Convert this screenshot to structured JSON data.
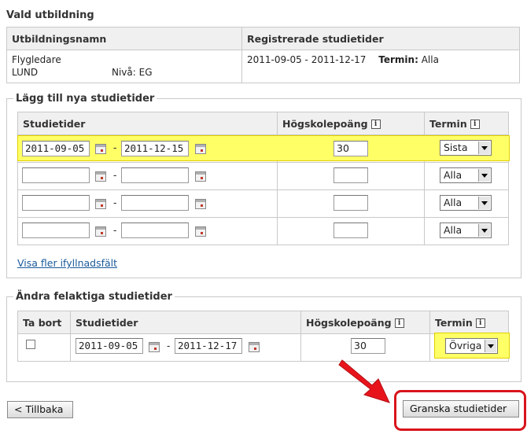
{
  "selected_education": {
    "title": "Vald utbildning",
    "col_name": "Utbildningsnamn",
    "col_registered": "Registrerade studietider",
    "name": "Flygledare",
    "location": "LUND",
    "level_label": "Nivå:",
    "level_value": "EG",
    "period": "2011-09-05 - 2011-12-17",
    "term_label": "Termin:",
    "term_value": "Alla"
  },
  "add_new": {
    "legend": "Lägg till nya studietider",
    "col_studietider": "Studietider",
    "col_hp": "Högskolepoäng",
    "col_termin": "Termin",
    "info_glyph": "i",
    "rows": [
      {
        "from": "2011-09-05",
        "to": "2011-12-15",
        "hp": "30",
        "term": "Sista"
      },
      {
        "from": "",
        "to": "",
        "hp": "",
        "term": "Alla"
      },
      {
        "from": "",
        "to": "",
        "hp": "",
        "term": "Alla"
      },
      {
        "from": "",
        "to": "",
        "hp": "",
        "term": "Alla"
      }
    ],
    "dash": "-",
    "more_fields_link": "Visa fler ifyllnadsfält"
  },
  "change_wrong": {
    "legend": "Ändra felaktiga studietider",
    "col_remove": "Ta bort",
    "col_studietider": "Studietider",
    "col_hp": "Högskolepoäng",
    "col_termin": "Termin",
    "row": {
      "from": "2011-09-05",
      "to": "2011-12-17",
      "hp": "30",
      "term": "Övriga"
    }
  },
  "buttons": {
    "back": "< Tillbaka",
    "review": "Granska studietider"
  },
  "colors": {
    "highlight": "#ffff66",
    "arrow": "#e8141c",
    "callout_border": "#d8141c",
    "link": "#1a5a9a"
  }
}
